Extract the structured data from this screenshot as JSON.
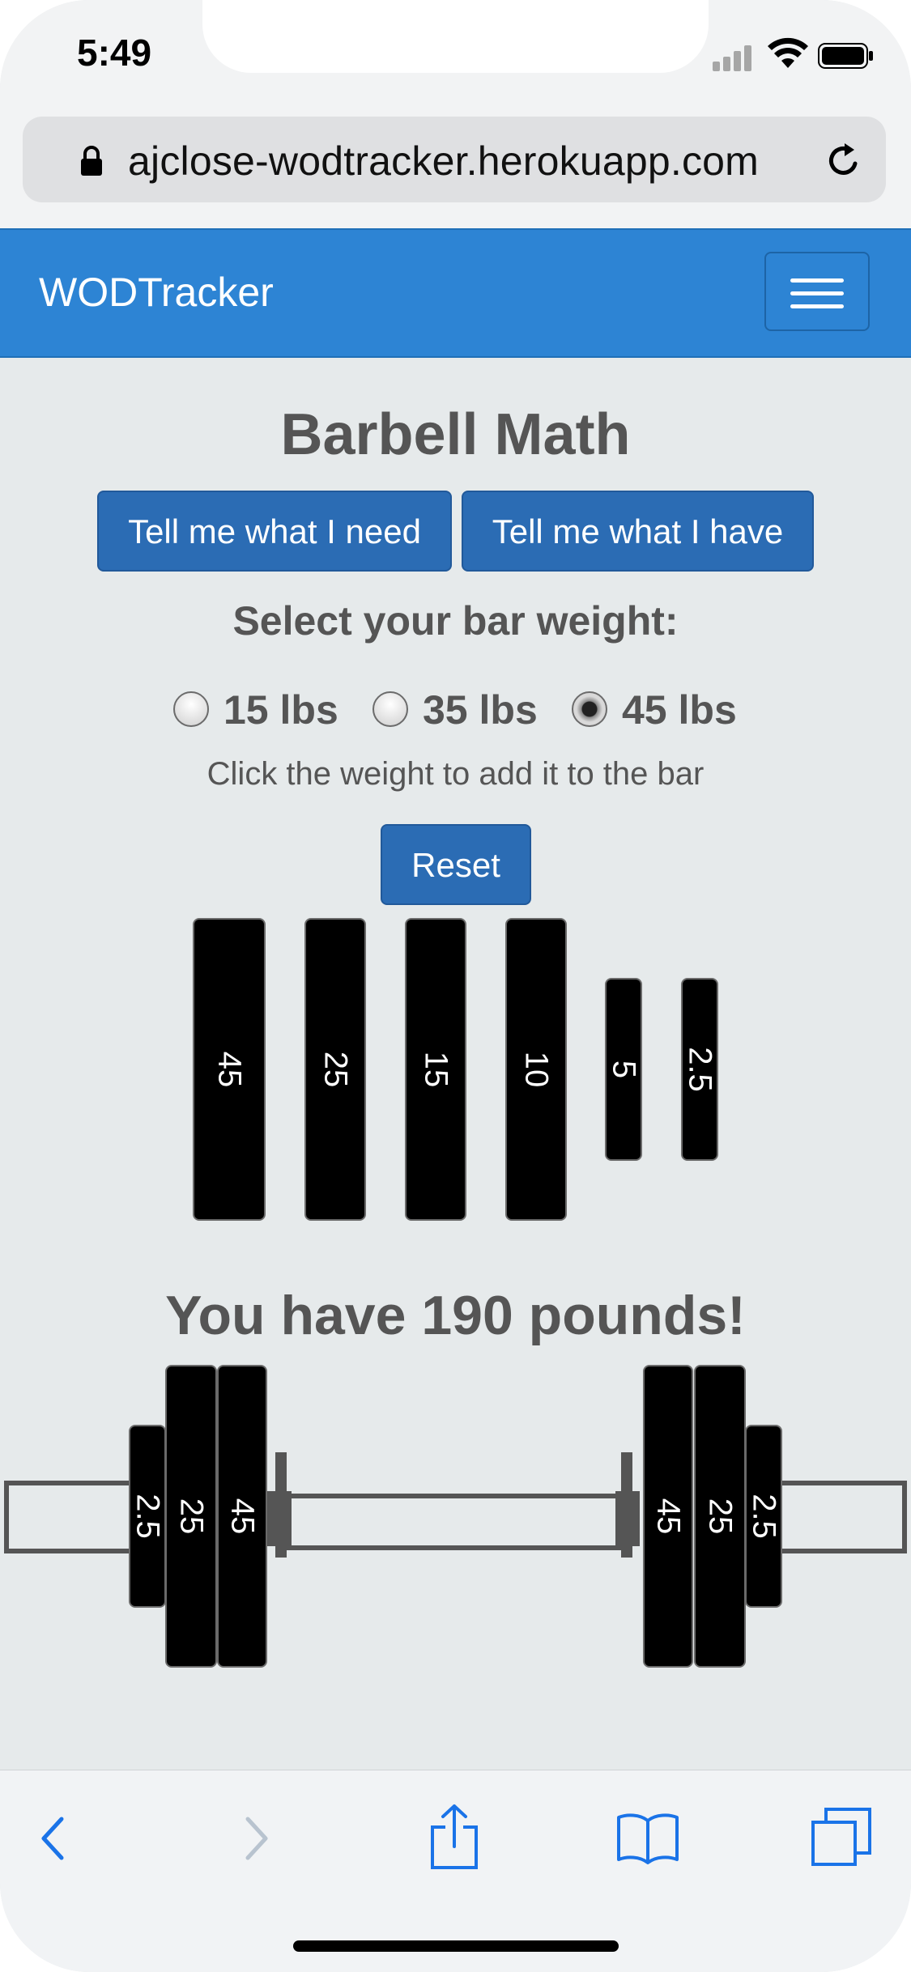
{
  "status": {
    "time": "5:49"
  },
  "browser": {
    "url": "ajclose-wodtracker.herokuapp.com"
  },
  "navbar": {
    "brand": "WODTracker"
  },
  "page": {
    "title": "Barbell Math",
    "btn_need": "Tell me what I need",
    "btn_have": "Tell me what I have",
    "select_label": "Select your bar weight:",
    "bar_options": [
      {
        "label": "15 lbs",
        "checked": false
      },
      {
        "label": "35 lbs",
        "checked": false
      },
      {
        "label": "45 lbs",
        "checked": true
      }
    ],
    "hint": "Click the weight to add it to the bar",
    "reset": "Reset",
    "plates": [
      "45",
      "25",
      "15",
      "10",
      "5",
      "2.5"
    ],
    "result": "You have 190 pounds!",
    "bar_left_plates": [
      "2.5",
      "25",
      "45"
    ],
    "bar_right_plates": [
      "45",
      "25",
      "2.5"
    ]
  },
  "icons": {
    "back": "chevron-left-icon",
    "forward": "chevron-right-icon",
    "share": "share-icon",
    "bookmarks": "book-icon",
    "tabs": "tabs-icon"
  }
}
